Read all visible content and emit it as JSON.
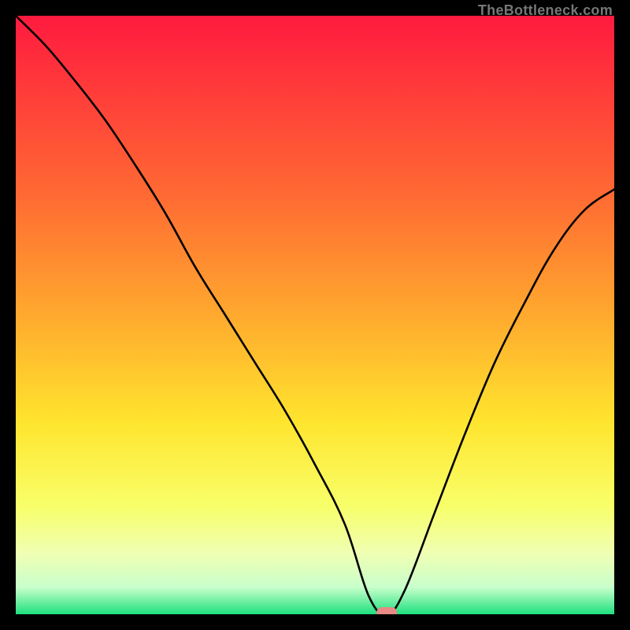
{
  "watermark": "TheBottleneck.com",
  "chart_data": {
    "type": "line",
    "title": "",
    "xlabel": "",
    "ylabel": "",
    "xlim": [
      0,
      100
    ],
    "ylim": [
      0,
      100
    ],
    "minimum_marker": {
      "x": 62,
      "y": 0,
      "color": "#e88a85"
    },
    "x": [
      0,
      5,
      10,
      15,
      20,
      25,
      30,
      35,
      40,
      45,
      50,
      55,
      59,
      62,
      65,
      70,
      75,
      80,
      85,
      90,
      95,
      100
    ],
    "values": [
      100,
      95,
      89,
      82.5,
      75,
      67,
      58,
      50,
      42,
      34,
      25,
      15,
      3,
      0,
      4,
      17,
      30,
      42,
      52,
      61,
      67.5,
      71
    ],
    "gradient_stops": [
      {
        "pct": 0.0,
        "color": "#ff1a3f"
      },
      {
        "pct": 0.12,
        "color": "#ff3a3a"
      },
      {
        "pct": 0.3,
        "color": "#ff6a33"
      },
      {
        "pct": 0.5,
        "color": "#ffa92e"
      },
      {
        "pct": 0.68,
        "color": "#ffe52e"
      },
      {
        "pct": 0.82,
        "color": "#f8ff6a"
      },
      {
        "pct": 0.9,
        "color": "#efffb4"
      },
      {
        "pct": 0.955,
        "color": "#c8ffcb"
      },
      {
        "pct": 1.0,
        "color": "#1ee07e"
      }
    ]
  }
}
